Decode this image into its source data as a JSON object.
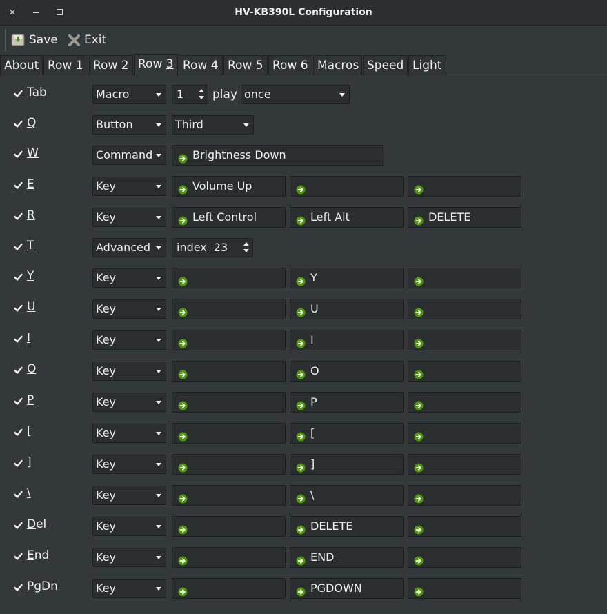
{
  "window": {
    "title": "HV-KB390L Configuration"
  },
  "toolbar": {
    "save_label": "Save",
    "exit_label": "Exit"
  },
  "tabs": [
    {
      "pre": "Abo",
      "u": "u",
      "post": "t"
    },
    {
      "pre": "Row ",
      "u": "1",
      "post": ""
    },
    {
      "pre": "Row ",
      "u": "2",
      "post": ""
    },
    {
      "pre": "Row ",
      "u": "3",
      "post": ""
    },
    {
      "pre": "Row ",
      "u": "4",
      "post": ""
    },
    {
      "pre": "Row ",
      "u": "5",
      "post": ""
    },
    {
      "pre": "Row ",
      "u": "6",
      "post": ""
    },
    {
      "pre": "",
      "u": "M",
      "post": "acros"
    },
    {
      "pre": "",
      "u": "S",
      "post": "peed"
    },
    {
      "pre": "",
      "u": "L",
      "post": "ight"
    }
  ],
  "active_tab": "Row 3",
  "rows": [
    {
      "label_u": "T",
      "label_rest": "ab",
      "checked": true,
      "mode": "Macro",
      "spin_value": "1",
      "play_label": "play",
      "play_u": "p",
      "play_rest": "lay",
      "play_mode": "once"
    },
    {
      "label_u": "Q",
      "label_rest": "",
      "checked": true,
      "mode": "Button",
      "button_value": "Third"
    },
    {
      "label_u": "W",
      "label_rest": "",
      "checked": true,
      "mode": "Command",
      "command_value": "Brightness Down"
    },
    {
      "label_u": "E",
      "label_rest": "",
      "checked": true,
      "mode": "Key",
      "keys": [
        "Volume Up",
        "",
        ""
      ]
    },
    {
      "label_u": "R",
      "label_rest": "",
      "checked": true,
      "mode": "Key",
      "keys": [
        "Left Control",
        "Left Alt",
        "DELETE"
      ]
    },
    {
      "label_u": "T",
      "label_rest": "",
      "checked": true,
      "mode": "Advanced",
      "index_label": "index",
      "index_value": "23"
    },
    {
      "label_u": "Y",
      "label_rest": "",
      "checked": true,
      "mode": "Key",
      "keys": [
        "",
        "Y",
        ""
      ]
    },
    {
      "label_u": "U",
      "label_rest": "",
      "checked": true,
      "mode": "Key",
      "keys": [
        "",
        "U",
        ""
      ]
    },
    {
      "label_u": "I",
      "label_rest": "",
      "checked": true,
      "mode": "Key",
      "keys": [
        "",
        "I",
        ""
      ]
    },
    {
      "label_u": "O",
      "label_rest": "",
      "checked": true,
      "mode": "Key",
      "keys": [
        "",
        "O",
        ""
      ]
    },
    {
      "label_u": "P",
      "label_rest": "",
      "checked": true,
      "mode": "Key",
      "keys": [
        "",
        "P",
        ""
      ]
    },
    {
      "label_u": "[",
      "label_rest": "",
      "checked": true,
      "mode": "Key",
      "keys": [
        "",
        "[",
        ""
      ]
    },
    {
      "label_u": "]",
      "label_rest": "",
      "checked": true,
      "mode": "Key",
      "keys": [
        "",
        "]",
        ""
      ]
    },
    {
      "label_u": "\\",
      "label_rest": "",
      "checked": true,
      "mode": "Key",
      "keys": [
        "",
        "\\",
        ""
      ]
    },
    {
      "label_u": "D",
      "label_rest": "el",
      "checked": true,
      "mode": "Key",
      "keys": [
        "",
        "DELETE",
        ""
      ]
    },
    {
      "label_u": "E",
      "label_rest": "nd",
      "checked": true,
      "mode": "Key",
      "keys": [
        "",
        "END",
        ""
      ]
    },
    {
      "label_u": "P",
      "label_rest": "gDn",
      "checked": true,
      "mode": "Key",
      "keys": [
        "",
        "PGDOWN",
        ""
      ]
    }
  ],
  "colors": {
    "background": "#33393b",
    "field": "#2a2e2f",
    "arrow_icon": "#4e9a06"
  },
  "icons": {
    "save": "save-icon",
    "exit": "exit-icon",
    "key_entry": "go-arrow-icon",
    "check": "check-icon"
  }
}
